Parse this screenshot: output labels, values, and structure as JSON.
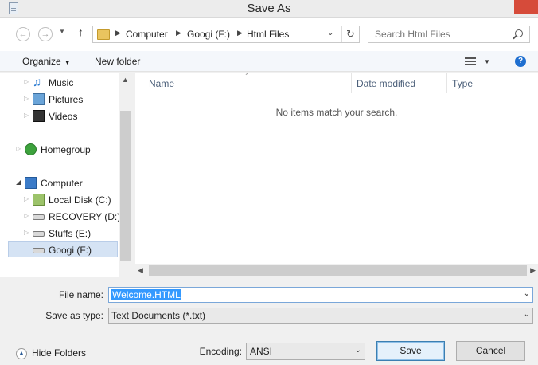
{
  "window": {
    "title": "Save As"
  },
  "address_bar": {
    "breadcrumbs": [
      "Computer",
      "Googi (F:)",
      "Html Files"
    ],
    "search_placeholder": "Search Html Files"
  },
  "toolbar": {
    "organize_label": "Organize",
    "new_folder_label": "New folder",
    "help_label": "?"
  },
  "nav_pane": {
    "items": [
      {
        "label": "Music",
        "icon": "music-icon"
      },
      {
        "label": "Pictures",
        "icon": "pictures-icon"
      },
      {
        "label": "Videos",
        "icon": "videos-icon"
      },
      {
        "label": "Homegroup",
        "icon": "homegroup-icon"
      },
      {
        "label": "Computer",
        "icon": "computer-icon"
      },
      {
        "label": "Local Disk (C:)",
        "icon": "local-disk-icon"
      },
      {
        "label": "RECOVERY (D:)",
        "icon": "drive-icon"
      },
      {
        "label": "Stuffs (E:)",
        "icon": "drive-icon"
      },
      {
        "label": "Googi (F:)",
        "icon": "drive-icon",
        "selected": true
      }
    ]
  },
  "file_list": {
    "columns": [
      "Name",
      "Date modified",
      "Type"
    ],
    "empty_message": "No items match your search."
  },
  "form": {
    "file_name_label": "File name:",
    "file_name_value": "Welcome.HTML",
    "save_as_type_label": "Save as type:",
    "save_as_type_value": "Text Documents (*.txt)",
    "hide_folders_label": "Hide Folders",
    "encoding_label": "Encoding:",
    "encoding_value": "ANSI",
    "save_label": "Save",
    "cancel_label": "Cancel"
  },
  "colors": {
    "selection": "#3399ff",
    "close_button": "#d64b3a",
    "nav_selected": "#d5e3f4"
  }
}
